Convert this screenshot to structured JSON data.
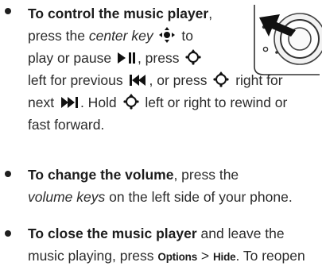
{
  "bullets": [
    {
      "title": "To control the music player",
      "l1_tail": ",",
      "l2_a": "press the ",
      "l2_italic": "center key",
      "l2_b": " to",
      "l3_a": "play or pause ",
      "l3_b": ", press",
      "l4_a": "left for previous ",
      "l4_b": ", or press",
      "l4_c": " right for",
      "l5_a": "next ",
      "l5_b": ". Hold ",
      "l5_c": " left or right to rewind or",
      "l6": "fast forward."
    },
    {
      "title": "To change the volume",
      "l1_tail": ", press the",
      "l2_italic": "volume keys",
      "l2_b": " on the left side of your phone."
    },
    {
      "title": "To close the music player",
      "l1_tail": " and leave the",
      "l2_a": "music playing, press ",
      "menu_options": "Options",
      "sep": " > ",
      "menu_hide": "Hide",
      "l2_b": ". To reopen"
    }
  ],
  "icons": {
    "nav": "navigation-key-icon",
    "play_pause": "play-pause-icon",
    "previous": "previous-track-icon",
    "next": "next-track-icon",
    "phone": "phone-nav-key-illustration"
  }
}
